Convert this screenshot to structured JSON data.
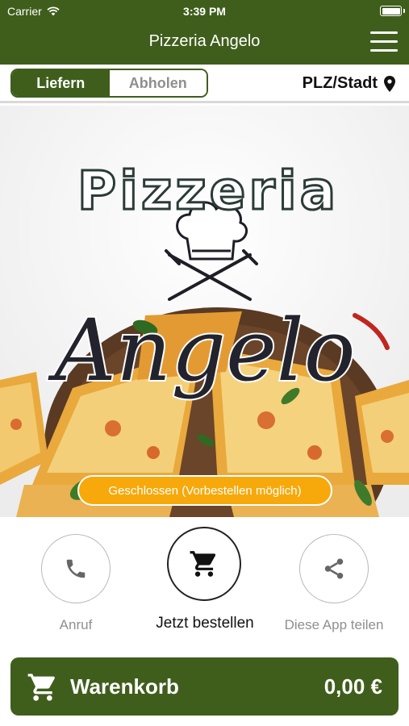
{
  "status_bar": {
    "carrier": "Carrier",
    "time": "3:39 PM"
  },
  "header": {
    "title": "Pizzeria Angelo",
    "menu_icon": "hamburger-menu-icon"
  },
  "order_mode": {
    "options": [
      "Liefern",
      "Abholen"
    ],
    "selected": "Liefern"
  },
  "location": {
    "label": "PLZ/Stadt",
    "icon": "location-pin-icon"
  },
  "hero": {
    "logo_top": "Pizzeria",
    "logo_bottom": "Angelo",
    "status_button": "Geschlossen (Vorbestellen möglich)"
  },
  "actions": [
    {
      "label": "Anruf",
      "icon": "phone-icon"
    },
    {
      "label": "Jetzt bestellen",
      "icon": "cart-icon"
    },
    {
      "label": "Diese App teilen",
      "icon": "share-icon"
    }
  ],
  "cart": {
    "label": "Warenkorb",
    "total": "0,00 €",
    "icon": "cart-icon"
  },
  "colors": {
    "brand_green": "#3f5e1c",
    "status_orange": "#f7a90b",
    "logo_dark": "#2b3b38",
    "logo_red": "#c5253d"
  }
}
